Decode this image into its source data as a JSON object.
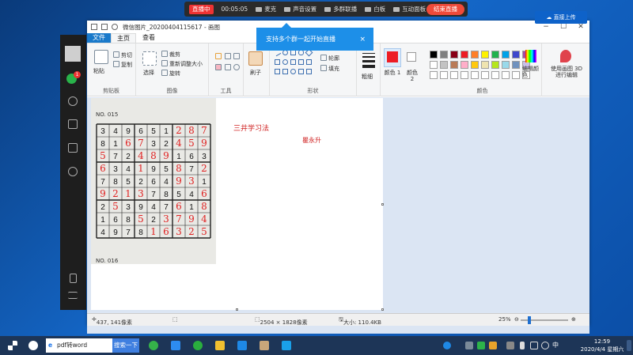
{
  "stream_bar": {
    "live_label": "直播中",
    "elapsed": "00:05:05",
    "items": [
      "麦克",
      "声音设置",
      "多群联播",
      "白板",
      "互动面板"
    ],
    "end_label": "结束直播"
  },
  "cloud_upload": {
    "label": "直接上传"
  },
  "toast": {
    "text": "支持多个群一起开始直播",
    "close": "×"
  },
  "paint": {
    "title": "微信图片_20200404115617 - 画图",
    "tabs": {
      "file": "文件",
      "home": "主页",
      "view": "查看"
    },
    "ribbon": {
      "clipboard": {
        "paste": "粘贴",
        "cut": "剪切",
        "copy": "复制",
        "label": "剪贴板"
      },
      "image": {
        "select": "选择",
        "crop": "裁剪",
        "resize": "重新调整大小",
        "rotate": "旋转",
        "label": "图像"
      },
      "tools": {
        "label": "工具"
      },
      "brush": {
        "label": "刷子"
      },
      "shapes": {
        "outline": "轮廓",
        "fill": "填充",
        "label": "形状"
      },
      "size": {
        "label": "粗细"
      },
      "color1": {
        "label": "颜色 1"
      },
      "color2": {
        "label": "颜色 2"
      },
      "colors": {
        "label": "颜色",
        "palette": [
          "#000000",
          "#7f7f7f",
          "#880015",
          "#ed1c24",
          "#ff7f27",
          "#fff200",
          "#22b14c",
          "#00a2e8",
          "#3f48cc",
          "#a349a4",
          "#ffffff",
          "#c3c3c3",
          "#b97a57",
          "#ffaec9",
          "#ffc90e",
          "#efe4b0",
          "#b5e61d",
          "#99d9ea",
          "#7092be",
          "#c8bfe7"
        ],
        "primary": "#ed1c24"
      },
      "edit_colors": "编辑颜色",
      "paint3d": "使用画图 3D 进行编辑"
    },
    "canvas": {
      "photo_label_top": "NO. 015",
      "photo_label_bottom": "NO. 016",
      "note_title": "三井学习法",
      "note_name": "瞿永升",
      "grid": [
        [
          "3",
          "4",
          "9",
          "6",
          "5",
          "1",
          "2",
          "8",
          "7"
        ],
        [
          "8",
          "1",
          "6",
          "7",
          "3",
          "2",
          "4",
          "5",
          "9"
        ],
        [
          "5",
          "7",
          "2",
          "4",
          "8",
          "9",
          "1",
          "6",
          "3"
        ],
        [
          "6",
          "3",
          "4",
          "1",
          "9",
          "5",
          "8",
          "7",
          "2"
        ],
        [
          "7",
          "8",
          "5",
          "2",
          "6",
          "4",
          "9",
          "3",
          "1"
        ],
        [
          "9",
          "2",
          "1",
          "3",
          "7",
          "8",
          "5",
          "4",
          "6"
        ],
        [
          "2",
          "5",
          "3",
          "9",
          "4",
          "7",
          "6",
          "1",
          "8"
        ],
        [
          "1",
          "6",
          "8",
          "5",
          "2",
          "3",
          "7",
          "9",
          "4"
        ],
        [
          "4",
          "9",
          "7",
          "8",
          "1",
          "6",
          "3",
          "2",
          "5"
        ]
      ],
      "handwritten": [
        [
          0,
          0,
          0,
          0,
          0,
          0,
          1,
          1,
          1
        ],
        [
          0,
          0,
          1,
          1,
          0,
          0,
          1,
          1,
          1
        ],
        [
          1,
          0,
          0,
          1,
          1,
          1,
          0,
          0,
          0
        ],
        [
          1,
          0,
          0,
          1,
          0,
          0,
          1,
          0,
          1
        ],
        [
          0,
          0,
          0,
          0,
          0,
          0,
          1,
          1,
          0
        ],
        [
          1,
          1,
          1,
          1,
          0,
          0,
          0,
          0,
          1
        ],
        [
          0,
          1,
          0,
          0,
          0,
          0,
          1,
          0,
          1
        ],
        [
          0,
          0,
          0,
          1,
          0,
          1,
          1,
          1,
          1
        ],
        [
          0,
          0,
          0,
          0,
          1,
          1,
          1,
          1,
          1
        ]
      ]
    },
    "status": {
      "cursor": "437, 141像素",
      "dimensions": "2504 × 1828像素",
      "filesize": "大小: 110.4KB",
      "zoom": "25%"
    }
  },
  "taskbar": {
    "search_value": "pdf转word",
    "search_button": "搜索一下",
    "ime": "中",
    "time": "12:59",
    "date": "2020/4/4 星期六"
  }
}
